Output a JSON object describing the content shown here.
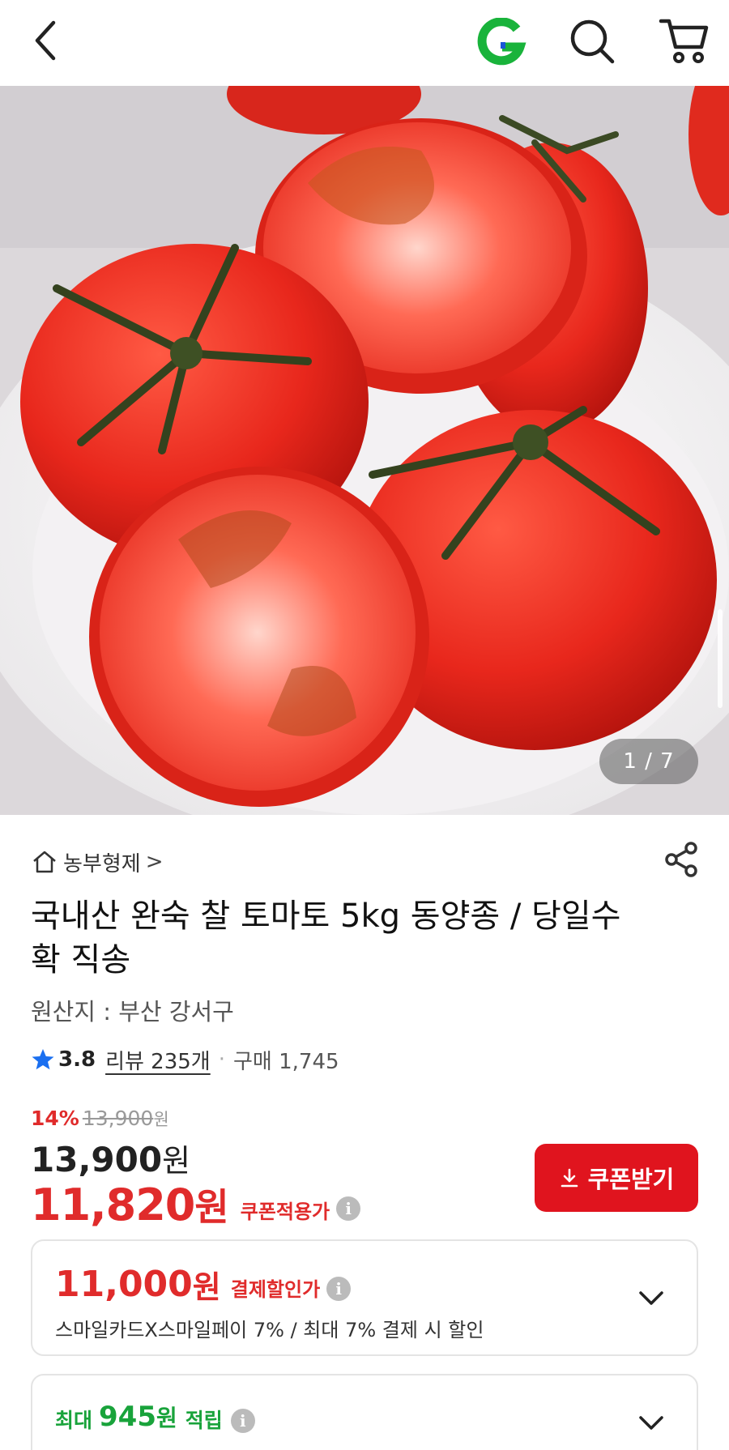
{
  "header": {
    "back_icon": "chevron-left-icon",
    "logo_icon": "gmarket-g-logo",
    "search_icon": "search-icon",
    "cart_icon": "cart-icon"
  },
  "gallery": {
    "counter": "1 / 7"
  },
  "product": {
    "store_name": "농부형제",
    "store_chevron": ">",
    "title": "국내산 완숙 찰 토마토 5kg 동양종 / 당일수확 직송",
    "origin": "원산지 : 부산 강서구",
    "rating": "3.8",
    "review": "리뷰 235개",
    "dot": "·",
    "purchase": "구매 1,745"
  },
  "pricing": {
    "discount_pct": "14%",
    "original_price": "13,900",
    "original_unit": "원",
    "price": "13,900",
    "price_unit": "원",
    "coupon_price": "11,820",
    "coupon_unit": "원",
    "coupon_label": "쿠폰적용가",
    "coupon_button": "쿠폰받기",
    "info_glyph": "i"
  },
  "payment_discount": {
    "amount": "11,000",
    "unit": "원",
    "label": "결제할인가",
    "description": "스마일카드X스마일페이 7% / 최대 7% 결제 시 할인"
  },
  "rewards": {
    "prefix": "최대",
    "amount": "945",
    "unit": "원",
    "suffix": "적립"
  },
  "colors": {
    "accent_red": "#e0141e",
    "reward_green": "#19a33b",
    "rating_star": "#1a6ff0"
  }
}
